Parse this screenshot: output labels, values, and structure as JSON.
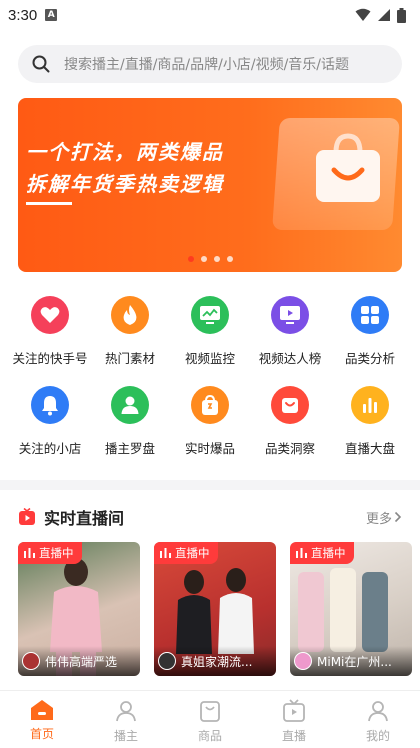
{
  "status_bar": {
    "time": "3:30",
    "notif_letter": "A"
  },
  "search": {
    "placeholder": "搜索播主/直播/商品/品牌/小店/视频/音乐/话题"
  },
  "banner": {
    "line1": "一个打法，两类爆品",
    "line2": "拆解年货季热卖逻辑",
    "slides": 4,
    "active_slide": 1
  },
  "grid": [
    [
      {
        "label": "关注的快手号",
        "icon": "heart-icon",
        "color": "#f5405a"
      },
      {
        "label": "热门素材",
        "icon": "flame-icon",
        "color": "#ff8a1e"
      },
      {
        "label": "视频监控",
        "icon": "monitor-chart-icon",
        "color": "#2cbf5a"
      },
      {
        "label": "视频达人榜",
        "icon": "video-play-icon",
        "color": "#7b4fe6"
      },
      {
        "label": "品类分析",
        "icon": "category-grid-icon",
        "color": "#2f7cf6"
      }
    ],
    [
      {
        "label": "关注的小店",
        "icon": "bell-icon",
        "color": "#2f7cf6"
      },
      {
        "label": "播主罗盘",
        "icon": "person-icon",
        "color": "#2cbf5a"
      },
      {
        "label": "实时爆品",
        "icon": "shopping-bag-icon",
        "color": "#ff8a1e"
      },
      {
        "label": "品类洞察",
        "icon": "basket-icon",
        "color": "#ff4a3a"
      },
      {
        "label": "直播大盘",
        "icon": "bar-chart-icon",
        "color": "#ffb21e"
      }
    ]
  ],
  "live": {
    "title": "实时直播间",
    "more": "更多",
    "badge": "直播中",
    "cards": [
      {
        "name": "伟伟高端严选",
        "bg": "#c9b7a6",
        "avatar": "#a33"
      },
      {
        "name": "真姐家潮流...",
        "bg": "#c03a3a",
        "avatar": "#333"
      },
      {
        "name": "MiMi在广州...",
        "bg": "#d8d0c8",
        "avatar": "#e9c"
      }
    ]
  },
  "bottom_nav": [
    {
      "label": "首页",
      "icon": "home-icon",
      "active": true
    },
    {
      "label": "播主",
      "icon": "person-outline-icon",
      "active": false
    },
    {
      "label": "商品",
      "icon": "bag-outline-icon",
      "active": false
    },
    {
      "label": "直播",
      "icon": "tv-outline-icon",
      "active": false
    },
    {
      "label": "我的",
      "icon": "user-outline-icon",
      "active": false
    }
  ],
  "colors": {
    "accent": "#ff6a1a",
    "live_red": "#ff3b3b"
  }
}
